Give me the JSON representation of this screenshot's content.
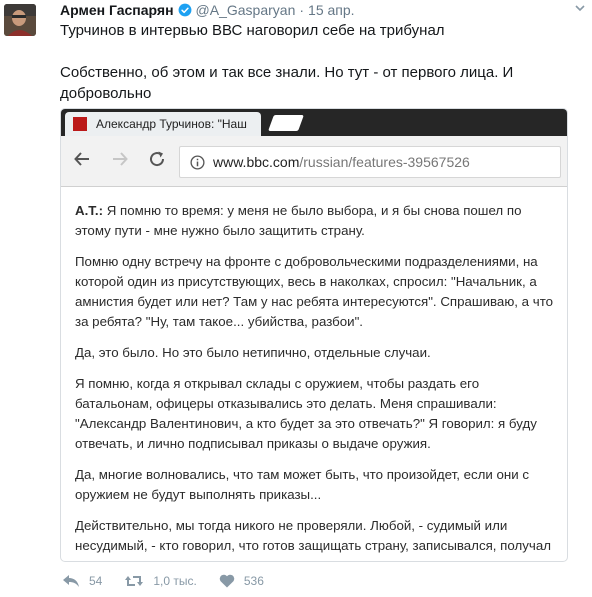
{
  "tweet": {
    "author_name": "Армен Гаспарян",
    "handle": "@A_Gasparyan",
    "separator": "·",
    "time": "15 апр.",
    "text_lines": [
      "Турчинов в интервью ВВС наговорил себе на трибунал",
      "Собственно, об этом и так все знали. Но тут - от первого лица. И добровольно"
    ],
    "verified_icon": "verified-badge-icon",
    "accent_color": "#1da1f2"
  },
  "browser": {
    "tab_title": "Александр Турчинов: \"Наш",
    "url_host": "www.bbc.com",
    "url_path": "/russian/features-39567526",
    "favicon_color": "#bb1919"
  },
  "article": {
    "speaker": "А.Т.:",
    "paragraphs": [
      "Я помню то время: у меня не было выбора, и я бы снова пошел по этому пути - мне нужно было защитить страну.",
      "Помню одну встречу на фронте с добровольческими подразделениями, на которой один из присутствующих, весь в наколках, спросил: \"Начальник, а амнистия будет или нет? Там у нас ребята интересуются\". Спрашиваю, а что за ребята? \"Ну, там такое... убийства, разбои\".",
      "Да, это было. Но это было нетипично, отдельные случаи.",
      "Я помню, когда я открывал склады с оружием, чтобы раздать его батальонам, офицеры отказывались это делать. Меня спрашивали: \"Александр Валентинович, а кто будет за это отвечать?\" Я говорил: я буду отвечать, и лично подписывал приказы о выдаче оружия.",
      "Да, многие волновались, что там может быть, что произойдет, если они с оружием не будут выполнять приказы...",
      "Действительно, мы тогда никого не проверяли. Любой, - судимый или несудимый, - кто говорил, что готов защищать страну, записывался, получал оружие и шел на восток."
    ]
  },
  "actions": {
    "reply_count": "54",
    "retweet_count": "1,0 тыс.",
    "like_count": "536"
  }
}
